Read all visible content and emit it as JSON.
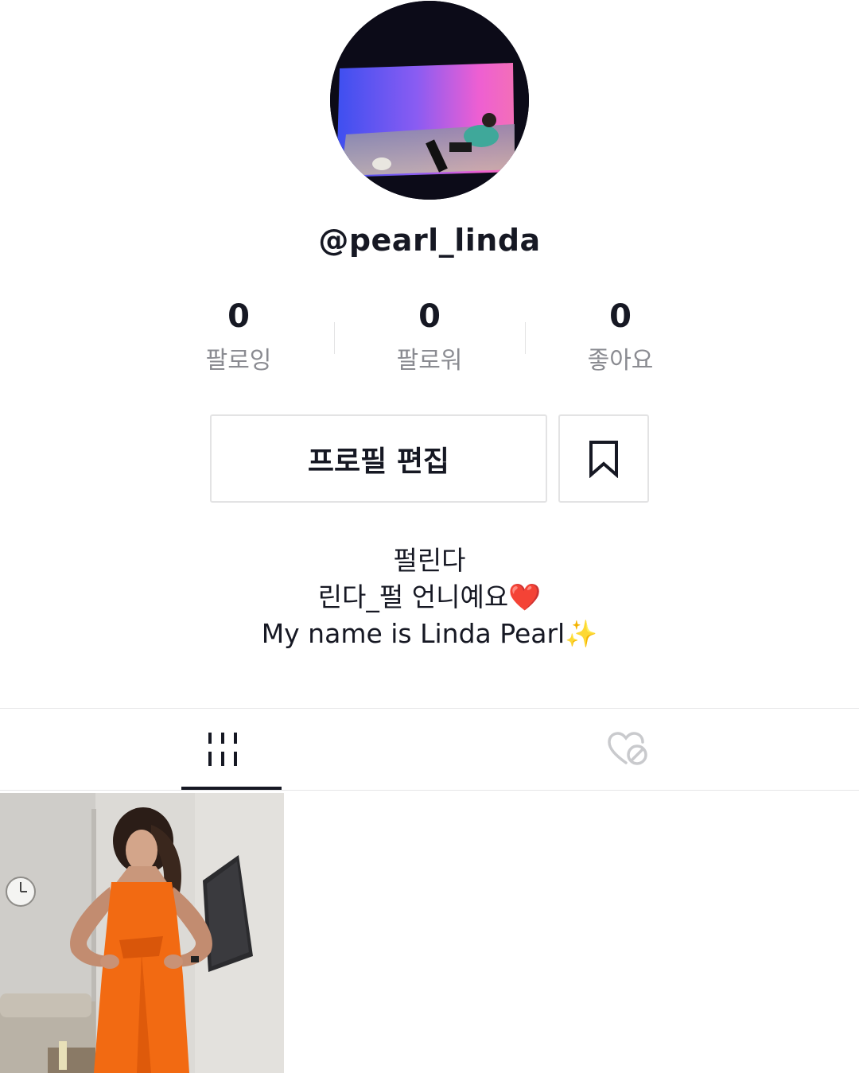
{
  "profile": {
    "username": "@pearl_linda",
    "stats": [
      {
        "value": "0",
        "label": "팔로잉"
      },
      {
        "value": "0",
        "label": "팔로워"
      },
      {
        "value": "0",
        "label": "좋아요"
      }
    ],
    "edit_profile_label": "프로필 편집",
    "bio": {
      "line1": "펄린다",
      "line2_text": "린다_펄 언니예요",
      "line2_emoji": "❤️",
      "line3_text": "My name is Linda Pearl",
      "line3_emoji": "✨"
    }
  },
  "tabs": {
    "videos_icon": "grid-bars-icon",
    "liked_icon": "liked-hidden-icon",
    "active": "videos"
  },
  "videos": [
    {
      "thumbnail": "woman-in-orange-dress"
    }
  ],
  "colors": {
    "text": "#161823",
    "muted": "#8a8b91",
    "border": "#e3e3e4",
    "heart": "#e0242e",
    "dress": "#f26a12"
  }
}
